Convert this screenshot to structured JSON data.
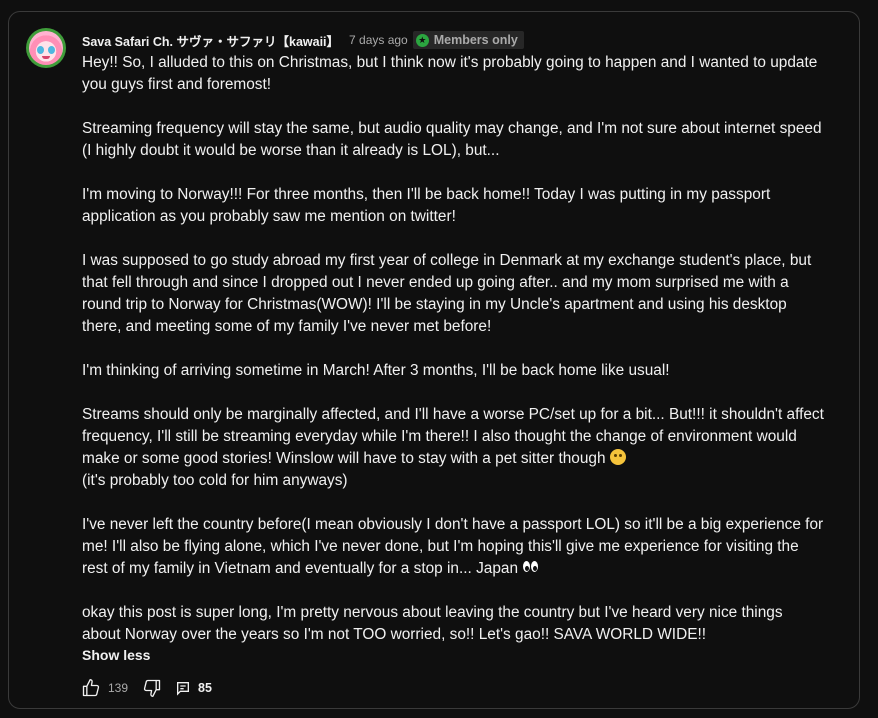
{
  "post": {
    "author": "Sava Safari Ch. サヴァ・サファリ【kawaii】",
    "time": "7 days ago",
    "badge": "Members only",
    "badge_icon": "star-icon",
    "paragraphs": [
      "Hey!! So, I alluded to this on Christmas, but I think now it's probably going to happen and I wanted to update you guys first and foremost!",
      "Streaming frequency will stay the same, but audio quality may change, and I'm not sure about internet speed (I highly doubt it would be worse than it already is LOL), but...",
      "I'm moving to Norway!!! For three months, then I'll be back home!! Today I was putting in my passport application as you probably saw me mention on twitter!",
      "I was supposed to go study abroad my first year of college in Denmark at my exchange student's place, but that fell through and since I dropped out I never ended up going after.. and my mom surprised me with a round trip to Norway for Christmas(WOW)! I'll be staying in my Uncle's apartment and using his desktop there, and meeting some of my family I've never met before!",
      "I'm thinking of arriving sometime in March! After 3 months, I'll be back home like usual!",
      "Streams should only be marginally affected, and I'll have a worse PC/set up for a bit... But!!! it shouldn't affect frequency, I'll still be streaming everyday while I'm there!! I also thought the change of environment would make or some good stories! Winslow will have to stay with a pet sitter though",
      "(it's probably too cold for him anyways)",
      "I've never left the country before(I mean obviously I don't have a passport LOL) so it'll be a big experience for me! I'll also be flying alone, which I've never done, but I'm hoping this'll give me experience for visiting the rest of my family in Vietnam and eventually for a stop in... Japan",
      "okay this post is super long, I'm pretty nervous about leaving the country but I've heard very nice things about Norway over the years so I'm not TOO worried, so!! Let's gao!! SAVA WORLD WIDE!!"
    ],
    "show_less": "Show less",
    "likes": "139",
    "replies": "85"
  },
  "colors": {
    "background": "#0f0f0f",
    "text": "#f1f1f1",
    "muted": "#aaaaaa",
    "badge_bg": "#272727",
    "member_green": "#2ba640"
  }
}
